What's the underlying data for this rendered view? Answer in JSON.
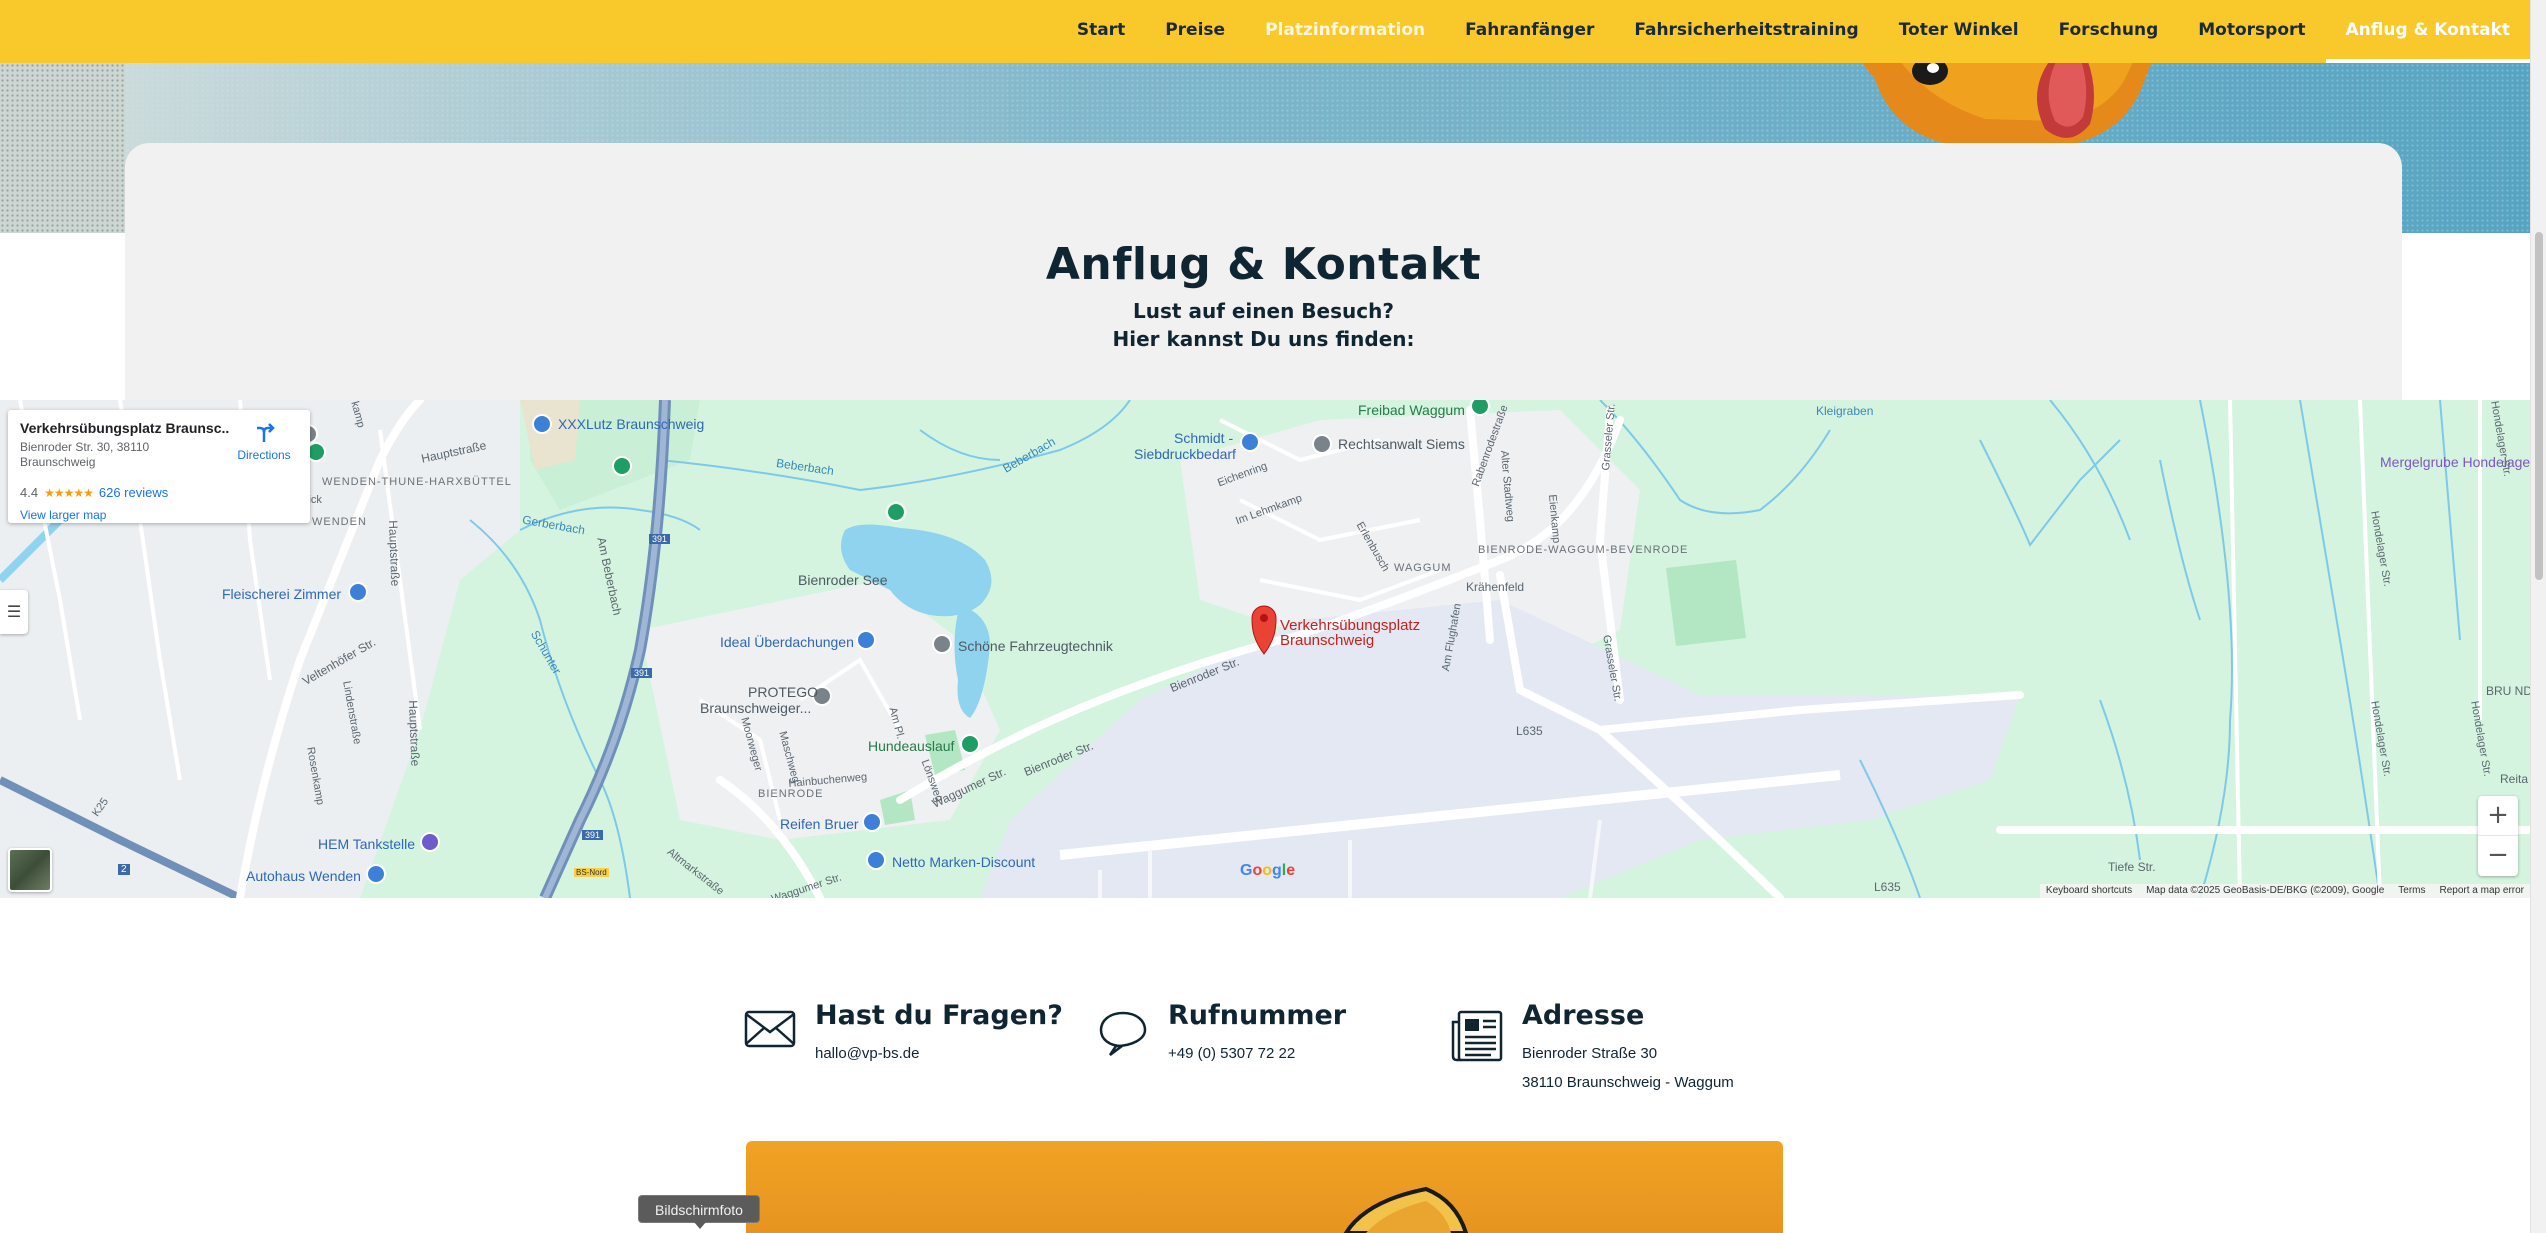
{
  "nav": {
    "items": [
      {
        "label": "Start"
      },
      {
        "label": "Preise"
      },
      {
        "label": "Platzinformation"
      },
      {
        "label": "Fahranfänger"
      },
      {
        "label": "Fahrsicherheitstraining"
      },
      {
        "label": "Toter Winkel"
      },
      {
        "label": "Forschung"
      },
      {
        "label": "Motorsport"
      },
      {
        "label": "Anflug & Kontakt"
      }
    ],
    "active_index": 8
  },
  "page": {
    "title": "Anflug & Kontakt",
    "subtitle_line1": "Lust auf einen Besuch?",
    "subtitle_line2": "Hier kannst Du uns finden:"
  },
  "map": {
    "place_card": {
      "name": "Verkehrsübungsplatz Braunsc...",
      "address_line1": "Bienroder Str. 30, 38110",
      "address_line2": "Braunschweig",
      "rating": "4.4",
      "stars": "★★★★★",
      "reviews": "626 reviews",
      "directions": "Directions",
      "larger_map": "View larger map"
    },
    "marker_label_line1": "Verkehrsübungsplatz",
    "marker_label_line2": "Braunschweig",
    "labels": {
      "freibad": "Freibad Waggum",
      "kleigraben": "Kleigraben",
      "mergelgrube": "Mergelgrube Hondelage",
      "xxxlutz": "XXXLutz Braunschweig",
      "schmidt1": "Schmidt -",
      "schmidt2": "Siebdruckbedarf",
      "rechtsanwalt": "Rechtsanwalt Siems",
      "wenden_harx": "WENDEN-THUNE-HARXBÜTTEL",
      "wenden": "WENDEN",
      "beberbach1": "Beberbach",
      "beberbach2": "Beberbach",
      "beberbach3": "Beberbach",
      "bienroder_see": "Bienroder See",
      "fleischerei": "Fleischerei Zimmer",
      "ideal": "Ideal Überdachungen",
      "schoene": "Schöne Fahrzeugtechnik",
      "protego1": "PROTEGO",
      "protego2": "Braunschweiger...",
      "hundeauslauf": "Hundeauslauf",
      "reifen": "Reifen Bruer",
      "netto": "Netto Marken-Discount",
      "hem": "HEM Tankstelle",
      "autohaus": "Autohaus Wenden",
      "waggum": "WAGGUM",
      "bienrode_waggum": "BIENRODE-WAGGUM-BEVENRODE",
      "bienrode": "BIENRODE",
      "kraehenfeld": "Krähenfeld",
      "l635a": "L635",
      "l635b": "L635",
      "tiefe_str": "Tiefe Str.",
      "bru_nd": "BRU ND",
      "reita": "Reita",
      "bienroder_str1": "Bienroder Str.",
      "bienroder_str2": "Bienroder Str.",
      "waggumer_str": "Waggumer Str.",
      "waggumer_str2": "Waggumer Str.",
      "am_beberbach": "Am Beberbach",
      "hauptstrasse1": "Hauptstraße",
      "hauptstrasse2": "Hauptstraße",
      "hauptstrasse3": "Hauptstraße",
      "veltenhoefer": "Veltenhöfer Str.",
      "lindenstrasse": "Lindenstraße",
      "rosenkamp": "Rosenkamp",
      "schunter": "Schunter",
      "gerberbach": "Gerberbach",
      "eichenring": "Eichenring",
      "im_lehmkamp": "Im Lehmkamp",
      "erlenbusch": "Erlenbusch",
      "rabenrodestr": "Rabenrodestraße",
      "alter_stadtweg": "Alter Stadtweg",
      "eienkamp": "Eienkamp",
      "grasseler1": "Grasseler Str.",
      "grasseler2": "Grasseler Str.",
      "am_flughafen": "Am Flughafen",
      "hondelager1": "Hondelager Str.",
      "hondelager2": "Hondelager Str.",
      "hondelager3": "Hondelager Str.",
      "hondelager4": "Hondelager Str.",
      "altmarkstrasse": "Altmarkstraße",
      "hainbuchenweg": "Hainbuchenweg",
      "moorweg": "Moorweger",
      "maschweg": "Maschweg",
      "am_pl": "Am Pl.",
      "loewenweg": "Lönsweg",
      "k25": "K25",
      "a2": "2",
      "a391a": "391",
      "a391b": "391",
      "a391c": "391",
      "kreuz": "BS-Nord",
      "wendenkamp": "kamp",
      "flick": "lick"
    },
    "google": "Google",
    "attribution": [
      "Keyboard shortcuts",
      "Map data ©2025 GeoBasis-DE/BKG (©2009), Google",
      "Terms",
      "Report a map error"
    ],
    "zoom_in": "+",
    "zoom_out": "−"
  },
  "contact": {
    "questions": {
      "title": "Hast du Fragen?",
      "email": "hallo@vp-bs.de"
    },
    "phone": {
      "title": "Rufnummer",
      "number": "+49 (0) 5307 72 22"
    },
    "address": {
      "title": "Adresse",
      "street": "Bienroder Straße 30",
      "city": "38110 Braunschweig - Waggum"
    }
  },
  "tooltip": "Bildschirmfoto",
  "colors": {
    "nav_bg": "#f9c82b",
    "heading": "#102532",
    "map_marker": "#ea4335"
  }
}
